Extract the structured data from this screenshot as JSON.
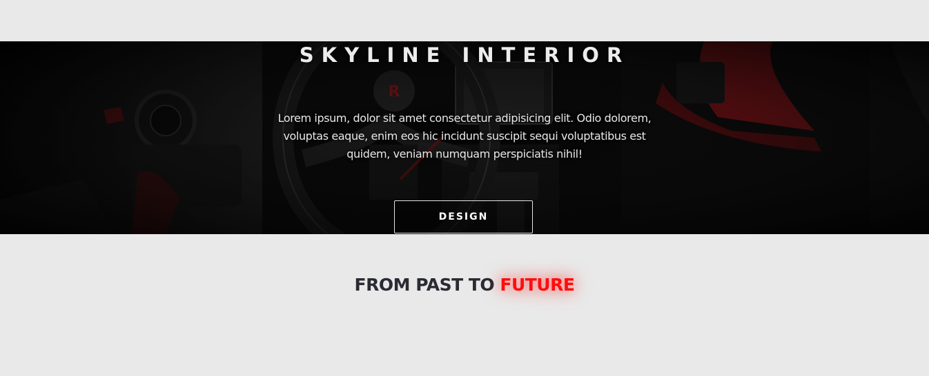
{
  "hero": {
    "title": "SKYLINE INTERIOR",
    "text": "Lorem ipsum, dolor sit amet consectetur adipisicing elit. Odio dolorem, voluptas eaque, enim eos hic incidunt suscipit sequi voluptatibus est quidem, veniam numquam perspiciatis nihil!",
    "button_label": "DESIGN",
    "background": "dark-car-interior-steering-wheel-red-accents"
  },
  "section": {
    "heading_part1": "FROM PAST TO",
    "heading_accent": "FUTURE"
  },
  "colors": {
    "page_background": "#e9e9e9",
    "heading_dark": "#2a2b33",
    "accent_red": "#ff0d0d",
    "hero_text": "#ececec"
  }
}
